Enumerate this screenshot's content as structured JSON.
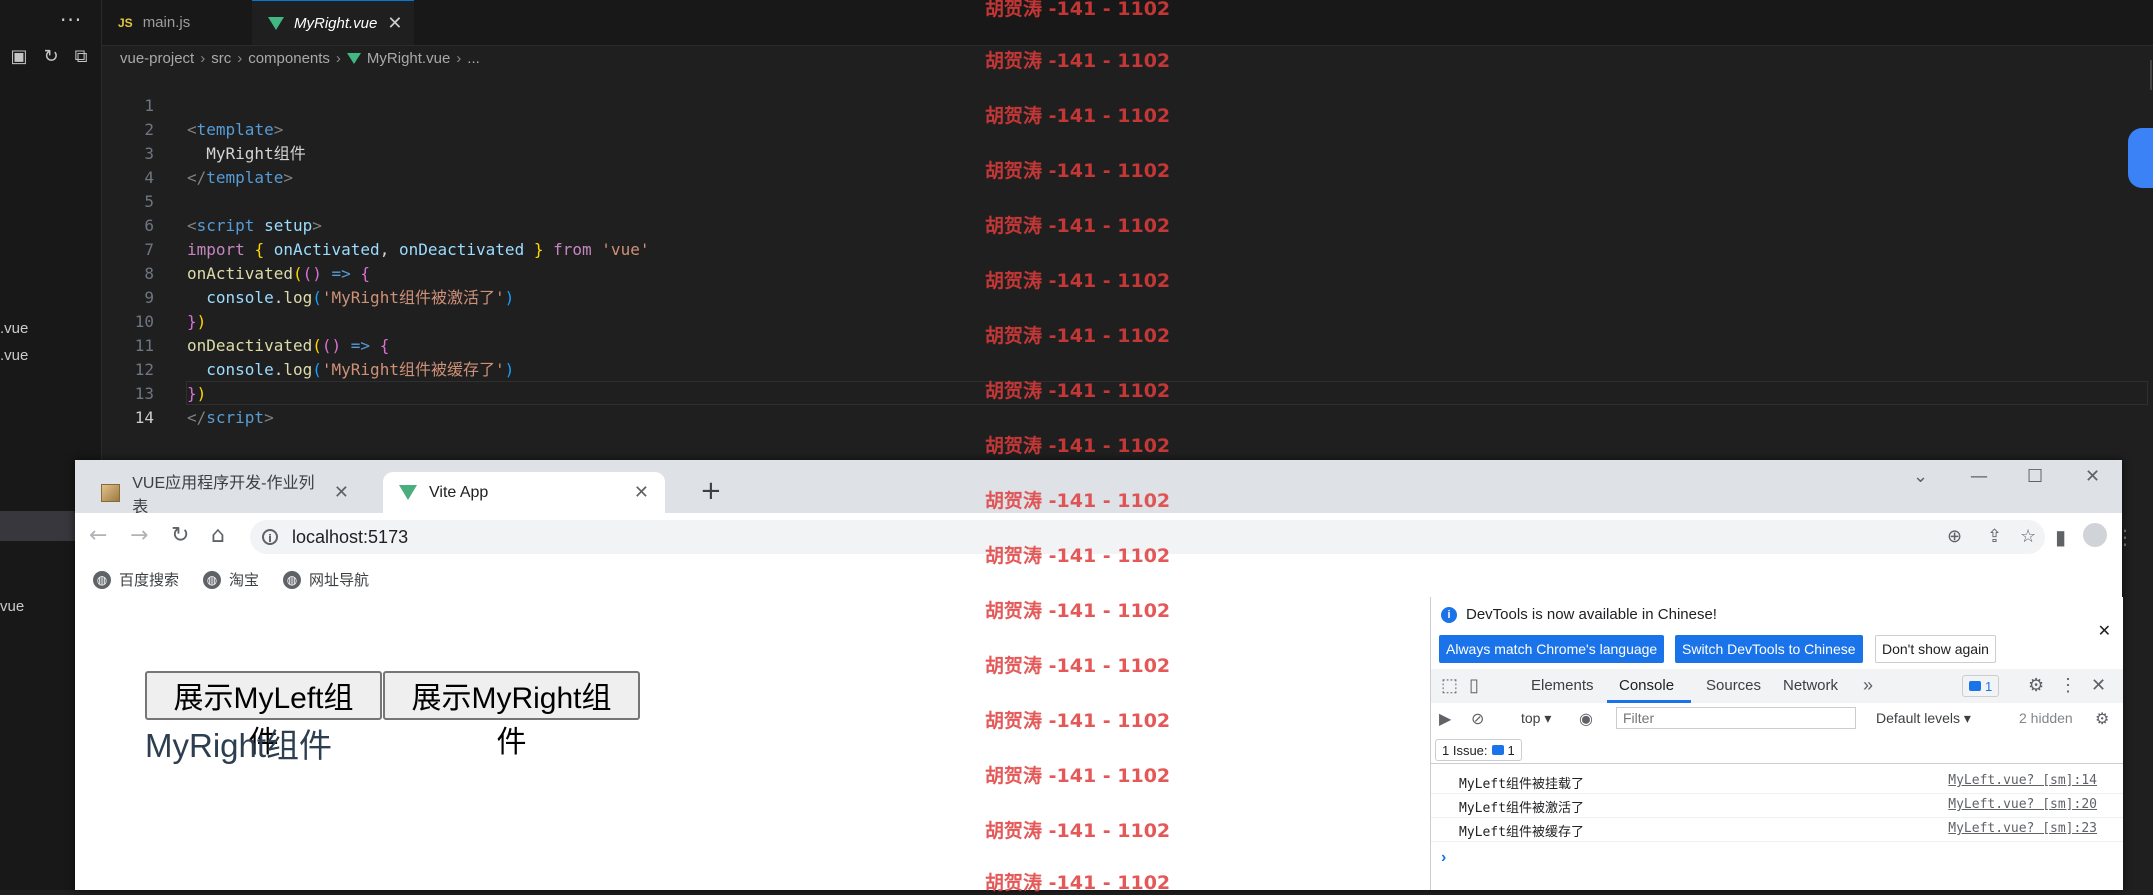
{
  "vscode": {
    "more": "···",
    "sidebar_files": [
      ".vue",
      ".vue",
      "vue"
    ],
    "tabs": [
      {
        "icon": "JS",
        "label": "main.js"
      },
      {
        "label": "MyRight.vue",
        "close": "✕"
      }
    ],
    "breadcrumb": [
      "vue-project",
      "src",
      "components",
      "MyRight.vue",
      "..."
    ],
    "line_numbers": [
      "1",
      "2",
      "3",
      "4",
      "5",
      "6",
      "7",
      "8",
      "9",
      "10",
      "11",
      "12",
      "13",
      "14"
    ]
  },
  "code": {
    "l1_tag": "template",
    "l2_text": "  MyRight组件",
    "l3_tag": "template",
    "l5_tag": "script",
    "l5_attr": "setup",
    "l6_import": "import",
    "l6_a": "onActivated",
    "l6_b": "onDeactivated",
    "l6_from": "from",
    "l6_str": "'vue'",
    "l7_fn": "onActivated",
    "l8_console": "console",
    "l8_log": "log",
    "l8_str": "'MyRight组件被激活了'",
    "l10_fn": "onDeactivated",
    "l11_console": "console",
    "l11_log": "log",
    "l11_str": "'MyRight组件被缓存了'",
    "l13_tag": "script"
  },
  "chrome": {
    "tabs": [
      {
        "label": "VUE应用程序开发-作业列表"
      },
      {
        "label": "Vite App"
      }
    ],
    "new_tab": "+",
    "url": "localhost:5173",
    "bookmarks": [
      "百度搜索",
      "淘宝",
      "网址导航"
    ]
  },
  "page": {
    "btn_left": "展示MyLeft组件",
    "btn_right": "展示MyRight组件",
    "heading": "MyRight组件"
  },
  "devtools": {
    "notice": "DevTools is now available in Chinese!",
    "btn_match": "Always match Chrome's language",
    "btn_switch": "Switch DevTools to Chinese",
    "btn_dont": "Don't show again",
    "tabs": [
      "Elements",
      "Console",
      "Sources",
      "Network"
    ],
    "issue_count": "1",
    "context": "top",
    "filter_placeholder": "Filter",
    "levels": "Default levels",
    "hidden": "2 hidden",
    "issues_label": "1 Issue:",
    "issues_count": "1",
    "logs": [
      {
        "msg": "MyLeft组件被挂载了",
        "src": "MyLeft.vue? [sm]:14"
      },
      {
        "msg": "MyLeft组件被激活了",
        "src": "MyLeft.vue? [sm]:20"
      },
      {
        "msg": "MyLeft组件被缓存了",
        "src": "MyLeft.vue? [sm]:23"
      }
    ]
  },
  "watermark": "胡贺涛 -141 - 1102"
}
